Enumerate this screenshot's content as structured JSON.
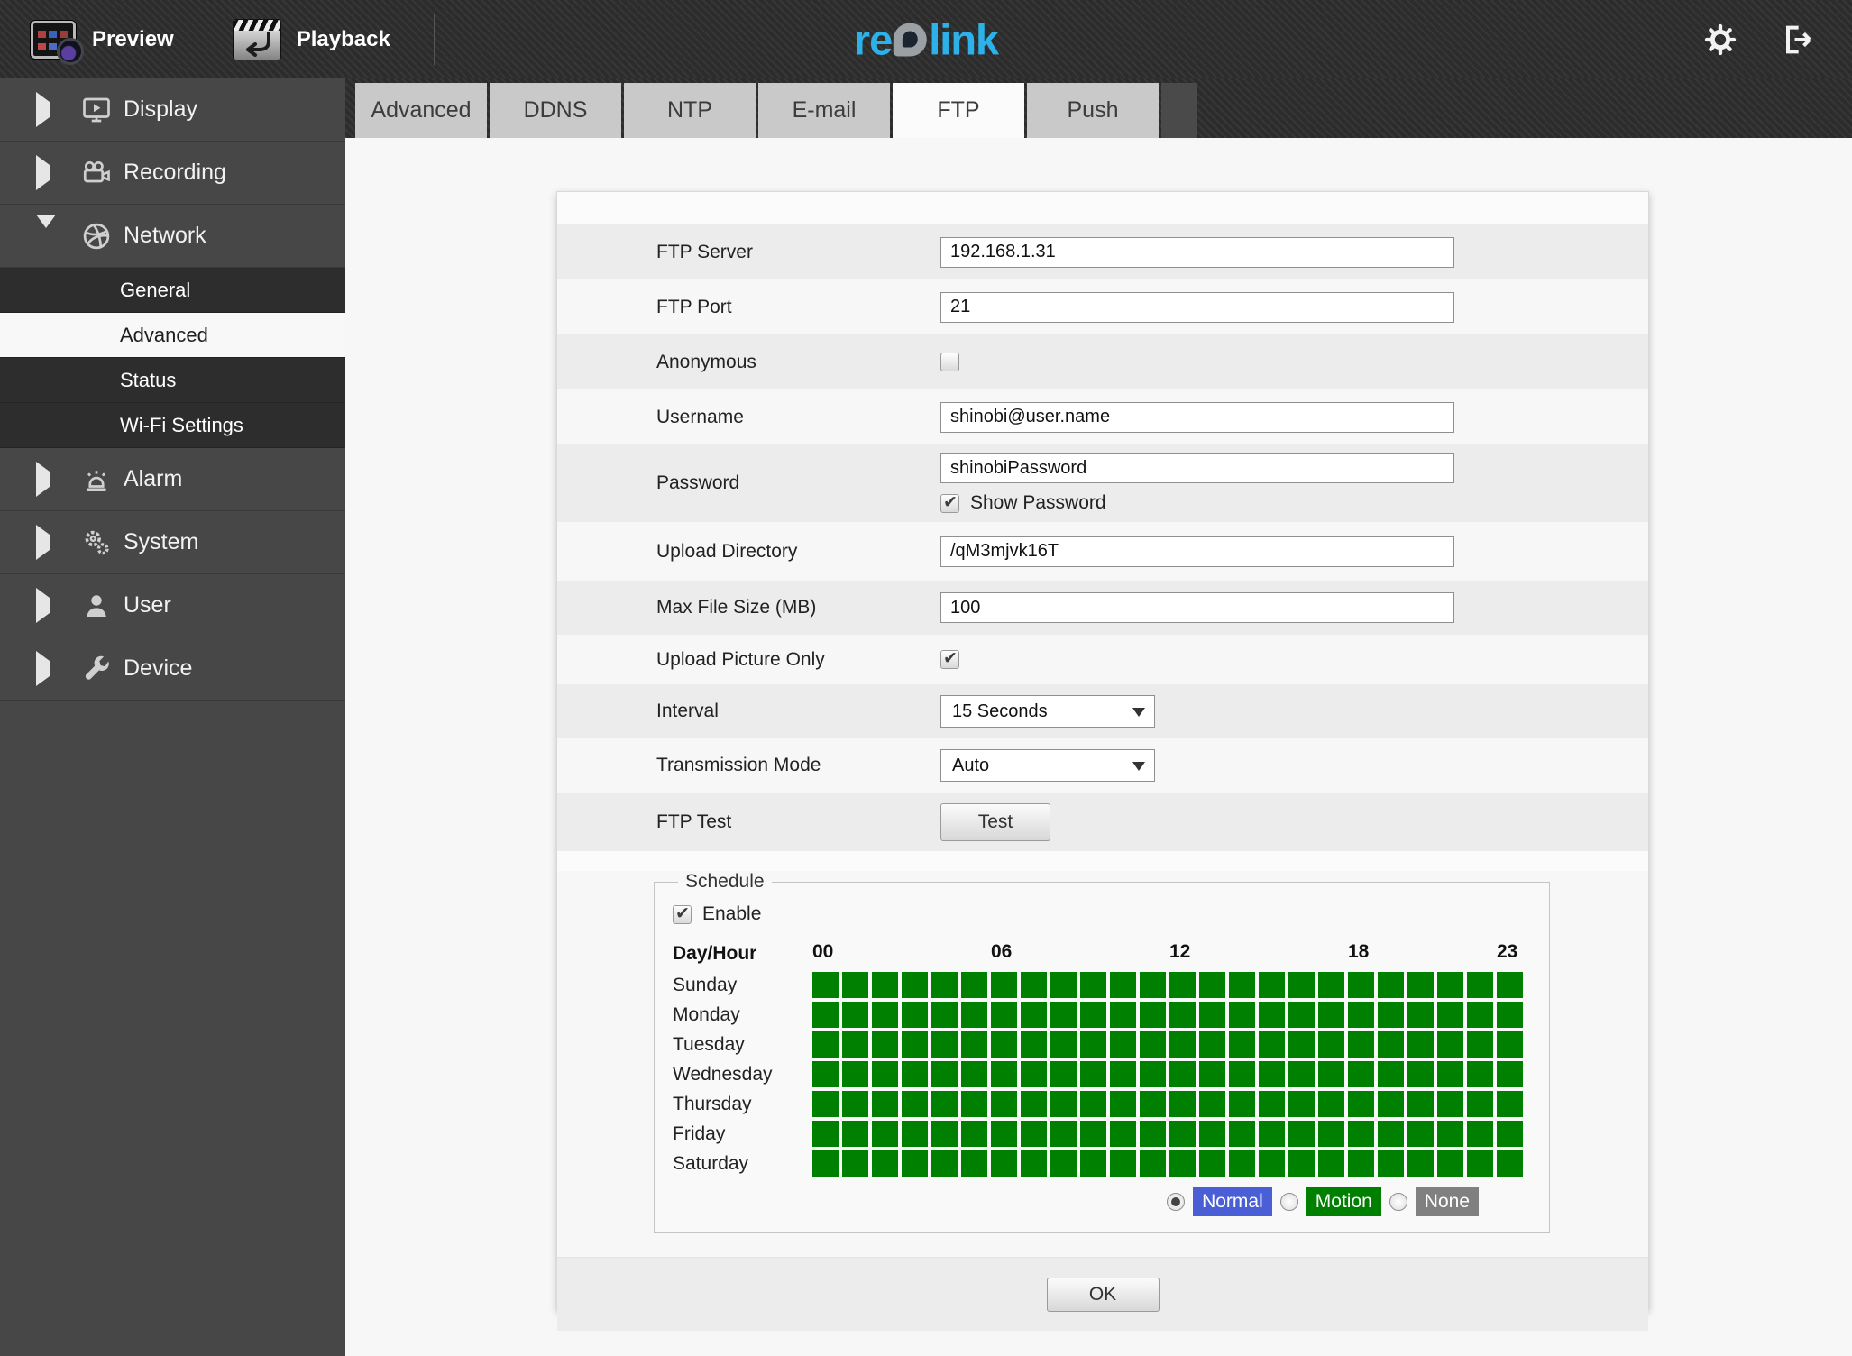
{
  "topbar": {
    "preview_label": "Preview",
    "playback_label": "Playback",
    "logo_re": "re",
    "logo_link": "link"
  },
  "sidebar": {
    "items": [
      {
        "label": "Display"
      },
      {
        "label": "Recording"
      },
      {
        "label": "Network",
        "expanded": true,
        "children": [
          {
            "label": "General"
          },
          {
            "label": "Advanced",
            "selected": true
          },
          {
            "label": "Status"
          },
          {
            "label": "Wi-Fi Settings"
          }
        ]
      },
      {
        "label": "Alarm"
      },
      {
        "label": "System"
      },
      {
        "label": "User"
      },
      {
        "label": "Device"
      }
    ]
  },
  "tabs": {
    "items": [
      "Advanced",
      "DDNS",
      "NTP",
      "E-mail",
      "FTP",
      "Push"
    ],
    "active": "FTP"
  },
  "form": {
    "ftp_server": {
      "label": "FTP Server",
      "value": "192.168.1.31"
    },
    "ftp_port": {
      "label": "FTP Port",
      "value": "21"
    },
    "anonymous": {
      "label": "Anonymous",
      "checked": false
    },
    "username": {
      "label": "Username",
      "value": "shinobi@user.name"
    },
    "password": {
      "label": "Password",
      "value": "shinobiPassword",
      "show_password_label": "Show Password",
      "show_password_checked": true
    },
    "upload_directory": {
      "label": "Upload Directory",
      "value": "/qM3mjvk16T"
    },
    "max_file_size": {
      "label": "Max File Size (MB)",
      "value": "100"
    },
    "upload_picture_only": {
      "label": "Upload Picture Only",
      "checked": true
    },
    "interval": {
      "label": "Interval",
      "value": "15 Seconds"
    },
    "transmission_mode": {
      "label": "Transmission Mode",
      "value": "Auto"
    },
    "ftp_test": {
      "label": "FTP Test",
      "button_label": "Test"
    }
  },
  "schedule": {
    "legend": "Schedule",
    "enable_label": "Enable",
    "enabled": true,
    "corner_label": "Day/Hour",
    "columns": 24,
    "hour_labels": [
      {
        "text": "00",
        "col": 0
      },
      {
        "text": "06",
        "col": 6
      },
      {
        "text": "12",
        "col": 12
      },
      {
        "text": "18",
        "col": 18
      },
      {
        "text": "23",
        "col": 23
      }
    ],
    "days": [
      "Sunday",
      "Monday",
      "Tuesday",
      "Wednesday",
      "Thursday",
      "Friday",
      "Saturday"
    ],
    "grid": [
      [
        1,
        1,
        1,
        1,
        1,
        1,
        1,
        1,
        1,
        1,
        1,
        1,
        1,
        1,
        1,
        1,
        1,
        1,
        1,
        1,
        1,
        1,
        1,
        1
      ],
      [
        1,
        1,
        1,
        1,
        1,
        1,
        1,
        1,
        1,
        1,
        1,
        1,
        1,
        1,
        1,
        1,
        1,
        1,
        1,
        1,
        1,
        1,
        1,
        1
      ],
      [
        1,
        1,
        1,
        1,
        1,
        1,
        1,
        1,
        1,
        1,
        1,
        1,
        1,
        1,
        1,
        1,
        1,
        1,
        1,
        1,
        1,
        1,
        1,
        1
      ],
      [
        1,
        1,
        1,
        1,
        1,
        1,
        1,
        1,
        1,
        1,
        1,
        1,
        1,
        1,
        1,
        1,
        1,
        1,
        1,
        1,
        1,
        1,
        1,
        1
      ],
      [
        1,
        1,
        1,
        1,
        1,
        1,
        1,
        1,
        1,
        1,
        1,
        1,
        1,
        1,
        1,
        1,
        1,
        1,
        1,
        1,
        1,
        1,
        1,
        1
      ],
      [
        1,
        1,
        1,
        1,
        1,
        1,
        1,
        1,
        1,
        1,
        1,
        1,
        1,
        1,
        1,
        1,
        1,
        1,
        1,
        1,
        1,
        1,
        1,
        1
      ],
      [
        1,
        1,
        1,
        1,
        1,
        1,
        1,
        1,
        1,
        1,
        1,
        1,
        1,
        1,
        1,
        1,
        1,
        1,
        1,
        1,
        1,
        1,
        1,
        1
      ]
    ],
    "cell_on_color": "#008000",
    "modes": [
      {
        "label": "Normal",
        "color": "#4a5fd6",
        "selected": true
      },
      {
        "label": "Motion",
        "color": "#008000",
        "selected": false
      },
      {
        "label": "None",
        "color": "#808080",
        "selected": false
      }
    ]
  },
  "ok_label": "OK"
}
